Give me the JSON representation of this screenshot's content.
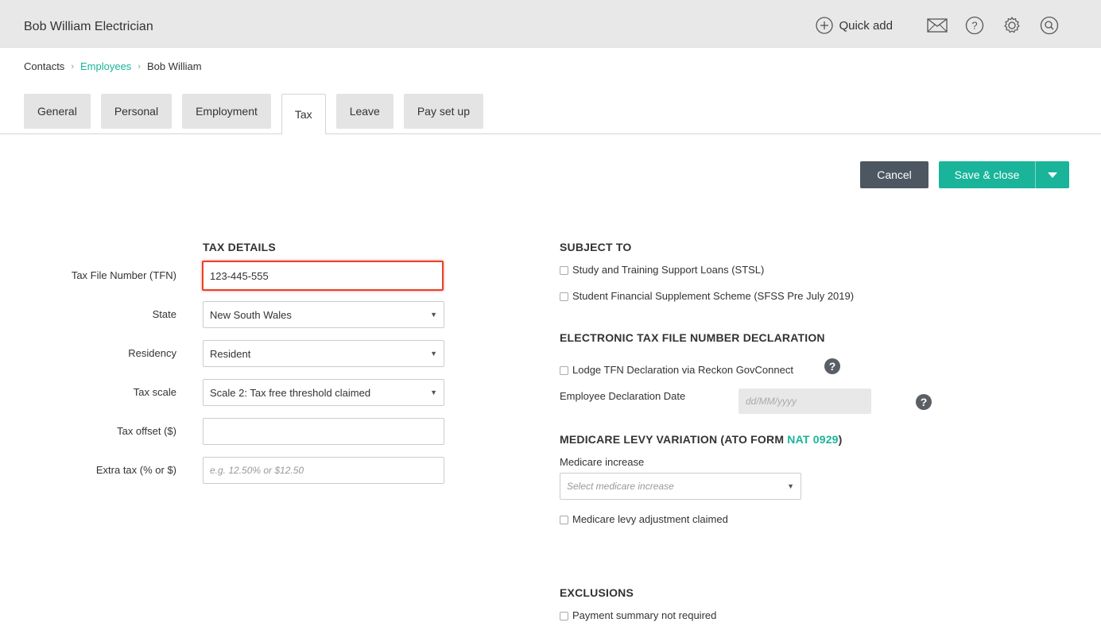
{
  "header": {
    "title": "Bob William Electrician",
    "quick_add_label": "Quick add"
  },
  "breadcrumb": {
    "items": [
      "Contacts",
      "Employees",
      "Bob William"
    ]
  },
  "tabs": [
    "General",
    "Personal",
    "Employment",
    "Tax",
    "Leave",
    "Pay set up"
  ],
  "active_tab": "Tax",
  "actions": {
    "cancel_label": "Cancel",
    "save_label": "Save & close"
  },
  "tax_details": {
    "title": "TAX DETAILS",
    "tfn_label": "Tax File Number (TFN)",
    "tfn_value": "123-445-555",
    "state_label": "State",
    "state_value": "New South Wales",
    "residency_label": "Residency",
    "residency_value": "Resident",
    "tax_scale_label": "Tax scale",
    "tax_scale_value": "Scale 2: Tax free threshold claimed",
    "tax_offset_label": "Tax offset ($)",
    "tax_offset_value": "",
    "extra_tax_label": "Extra tax (% or $)",
    "extra_tax_placeholder": "e.g. 12.50% or $12.50"
  },
  "subject_to": {
    "title": "SUBJECT TO",
    "stsl_label": "Study and Training Support Loans (STSL)",
    "sfss_label": "Student Financial Supplement Scheme (SFSS Pre July 2019)"
  },
  "etfn": {
    "title": "ELECTRONIC TAX FILE NUMBER DECLARATION",
    "lodge_label": "Lodge TFN Declaration via Reckon GovConnect",
    "declaration_date_label": "Employee Declaration Date",
    "declaration_date_placeholder": "dd/MM/yyyy"
  },
  "medicare": {
    "title_prefix": "MEDICARE LEVY VARIATION (ATO FORM ",
    "title_link": "NAT 0929",
    "title_suffix": ")",
    "increase_label": "Medicare increase",
    "increase_placeholder": "Select medicare increase",
    "adjustment_label": "Medicare levy adjustment claimed"
  },
  "exclusions": {
    "title": "EXCLUSIONS",
    "payment_summary_label": "Payment summary not required"
  },
  "colors": {
    "accent": "#19b49a",
    "dark_button": "#4c5762",
    "highlight": "#e8412b"
  }
}
